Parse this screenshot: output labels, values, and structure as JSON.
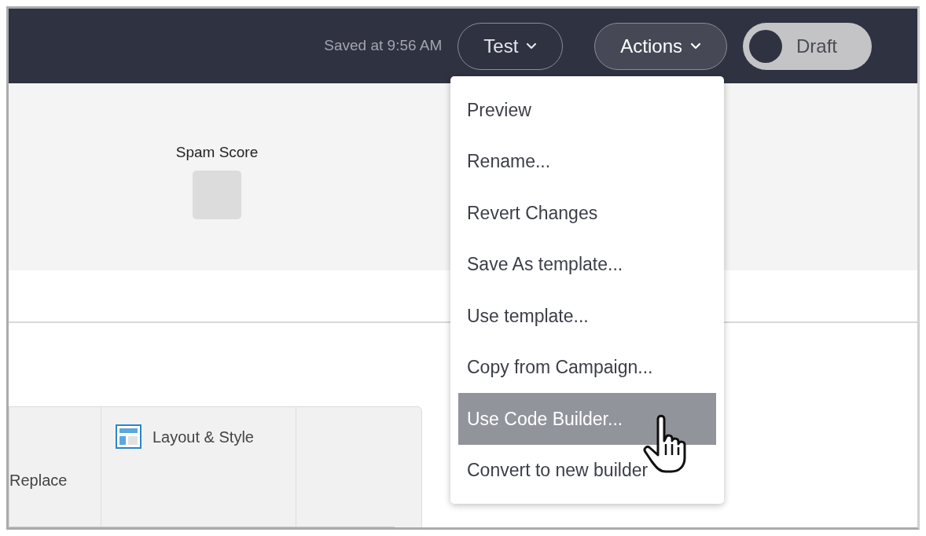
{
  "header": {
    "saved_status": "Saved at 9:56 AM",
    "test_button": "Test",
    "actions_button": {
      "label": "Actions",
      "expanded": true
    },
    "status_toggle": {
      "label": "Draft",
      "on": false
    }
  },
  "summary": {
    "spam_score_label": "Spam Score"
  },
  "actions_menu": [
    {
      "label": "Preview",
      "selected": false
    },
    {
      "label": "Rename...",
      "selected": false
    },
    {
      "label": "Revert Changes",
      "selected": false
    },
    {
      "label": "Save As template...",
      "selected": false
    },
    {
      "label": "Use template...",
      "selected": false
    },
    {
      "label": "Copy from Campaign...",
      "selected": false
    },
    {
      "label": "Use Code Builder...",
      "selected": true
    },
    {
      "label": "Convert to new builder",
      "selected": false
    }
  ],
  "toolbar": [
    {
      "label": "Replace",
      "kind": "text"
    },
    {
      "label": "Layout & Style",
      "kind": "icon"
    }
  ]
}
